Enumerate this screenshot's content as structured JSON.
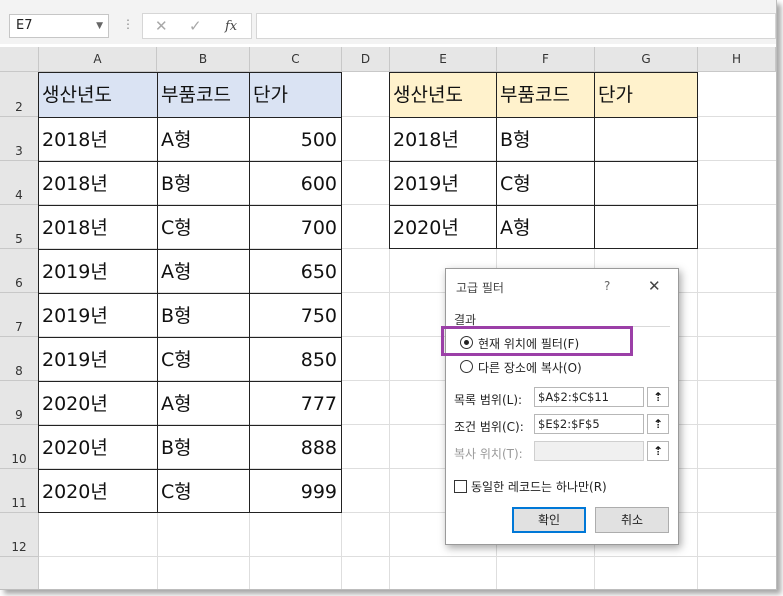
{
  "formula_bar": {
    "name_box": "E7",
    "cancel_glyph": "✕",
    "enter_glyph": "✓",
    "fx_label": "fx"
  },
  "columns": [
    "A",
    "B",
    "C",
    "D",
    "E",
    "F",
    "G",
    "H"
  ],
  "rows": [
    "2",
    "3",
    "4",
    "5",
    "6",
    "7",
    "8",
    "9",
    "10",
    "11",
    "12"
  ],
  "list_table": {
    "headers": [
      "생산년도",
      "부품코드",
      "단가"
    ],
    "rows": [
      [
        "2018년",
        "A형",
        "500"
      ],
      [
        "2018년",
        "B형",
        "600"
      ],
      [
        "2018년",
        "C형",
        "700"
      ],
      [
        "2019년",
        "A형",
        "650"
      ],
      [
        "2019년",
        "B형",
        "750"
      ],
      [
        "2019년",
        "C형",
        "850"
      ],
      [
        "2020년",
        "A형",
        "777"
      ],
      [
        "2020년",
        "B형",
        "888"
      ],
      [
        "2020년",
        "C형",
        "999"
      ]
    ]
  },
  "criteria_table": {
    "headers": [
      "생산년도",
      "부품코드",
      "단가"
    ],
    "rows": [
      [
        "2018년",
        "B형",
        ""
      ],
      [
        "2019년",
        "C형",
        ""
      ],
      [
        "2020년",
        "A형",
        ""
      ]
    ]
  },
  "dialog": {
    "title": "고급 필터",
    "help": "?",
    "close": "✕",
    "group_label": "결과",
    "option_inplace": "현재 위치에 필터(F)",
    "option_copy": "다른 장소에 복사(O)",
    "list_range_label": "목록 범위(L):",
    "list_range_value": "$A$2:$C$11",
    "criteria_range_label": "조건 범위(C):",
    "criteria_range_value": "$E$2:$F$5",
    "copy_to_label": "복사 위치(T):",
    "copy_to_value": "",
    "collapse_glyph": "⇡",
    "unique_label": "동일한 레코드는 하나만(R)",
    "ok_label": "확인",
    "cancel_label": "취소"
  },
  "colors": {
    "list_header_fill": "#dae3f3",
    "criteria_header_fill": "#fff2cc",
    "highlight_border": "#9b3fa7"
  }
}
